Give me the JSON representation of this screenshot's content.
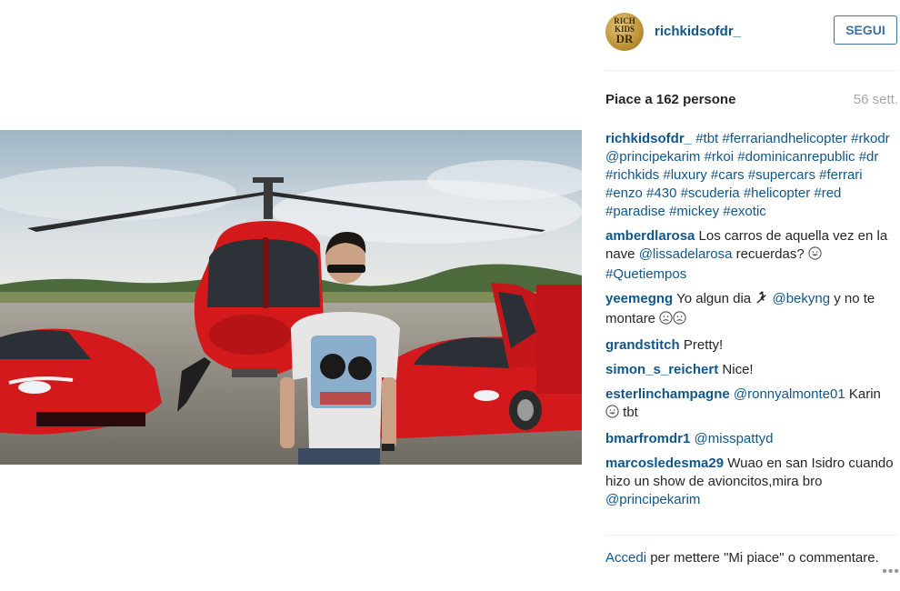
{
  "account": {
    "username": "richkidsofdr_",
    "avatar_text": [
      "RICH",
      "KIDS",
      "DR"
    ],
    "follow_label": "SEGUI"
  },
  "stats": {
    "likes_label": "Piace a 162 persone",
    "time_label": "56 sett."
  },
  "comments": [
    {
      "user": "richkidsofdr_",
      "parts": [
        {
          "t": " "
        },
        {
          "t": "#tbt",
          "tag": true
        },
        {
          "t": " "
        },
        {
          "t": "#ferrariandhelicopter",
          "tag": true
        },
        {
          "t": " "
        },
        {
          "t": "#rkodr",
          "tag": true
        },
        {
          "t": " "
        },
        {
          "t": "@principekarim",
          "tag": true
        },
        {
          "t": " "
        },
        {
          "t": "#rkoi",
          "tag": true
        },
        {
          "t": " "
        },
        {
          "t": "#dominicanrepublic",
          "tag": true
        },
        {
          "t": " "
        },
        {
          "t": "#dr",
          "tag": true
        },
        {
          "t": " "
        },
        {
          "t": "#richkids",
          "tag": true
        },
        {
          "t": " "
        },
        {
          "t": "#luxury",
          "tag": true
        },
        {
          "t": " "
        },
        {
          "t": "#cars",
          "tag": true
        },
        {
          "t": " "
        },
        {
          "t": "#supercars",
          "tag": true
        },
        {
          "t": " "
        },
        {
          "t": "#ferrari",
          "tag": true
        },
        {
          "t": " "
        },
        {
          "t": "#enzo",
          "tag": true
        },
        {
          "t": " "
        },
        {
          "t": "#430",
          "tag": true
        },
        {
          "t": " "
        },
        {
          "t": "#scuderia",
          "tag": true
        },
        {
          "t": " "
        },
        {
          "t": "#helicopter",
          "tag": true
        },
        {
          "t": " "
        },
        {
          "t": "#red",
          "tag": true
        },
        {
          "t": " "
        },
        {
          "t": "#paradise",
          "tag": true
        },
        {
          "t": " "
        },
        {
          "t": "#mickey",
          "tag": true
        },
        {
          "t": " "
        },
        {
          "t": "#exotic",
          "tag": true
        }
      ]
    },
    {
      "user": "amberdlarosa",
      "parts": [
        {
          "t": " Los carros de aquella vez en la nave "
        },
        {
          "t": "@lissadelarosa",
          "tag": true
        },
        {
          "t": " recuerdas? "
        },
        {
          "icon": "grin-emoji"
        },
        {
          "t": " "
        },
        {
          "t": "#Quetiempos",
          "tag": true
        }
      ]
    },
    {
      "user": "yeemegng",
      "parts": [
        {
          "t": " Yo algun dia "
        },
        {
          "icon": "ski-emoji"
        },
        {
          "t": " "
        },
        {
          "t": "@bekyng",
          "tag": true
        },
        {
          "t": " y no te montare "
        },
        {
          "icon": "sad-emoji"
        },
        {
          "icon": "sad-emoji"
        }
      ]
    },
    {
      "user": "grandstitch",
      "parts": [
        {
          "t": " Pretty!"
        }
      ]
    },
    {
      "user": "simon_s_reichert",
      "parts": [
        {
          "t": " Nice!"
        }
      ]
    },
    {
      "user": "esterlinchampagne",
      "parts": [
        {
          "t": " "
        },
        {
          "t": "@ronnyalmonte01",
          "tag": true
        },
        {
          "t": " Karin "
        },
        {
          "icon": "grin-emoji"
        },
        {
          "t": " tbt"
        }
      ]
    },
    {
      "user": "bmarfromdr1",
      "parts": [
        {
          "t": " "
        },
        {
          "t": "@misspattyd",
          "tag": true
        }
      ]
    },
    {
      "user": "marcosledesma29",
      "parts": [
        {
          "t": " Wuao en san Isidro cuando hizo un show de avioncitos,mira bro "
        },
        {
          "t": "@principekarim",
          "tag": true
        }
      ]
    }
  ],
  "footer": {
    "login_label": "Accedi",
    "rest_label": " per mettere \"Mi piace\" o commentare.",
    "more_label": "•••"
  },
  "colors": {
    "link": "#125688",
    "follow_border": "#3f729b",
    "car_red": "#d3191c",
    "text": "#262626",
    "muted": "#a5a7aa"
  }
}
